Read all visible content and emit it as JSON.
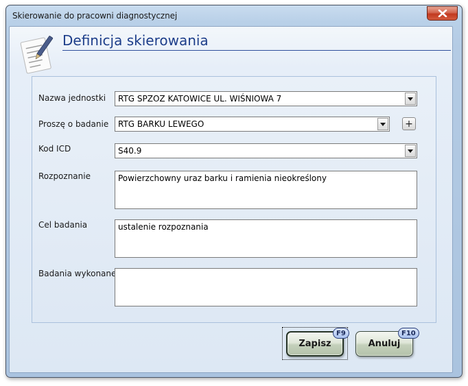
{
  "window": {
    "title": "Skierowanie do pracowni diagnostycznej"
  },
  "header": {
    "title": "Definicja skierowania",
    "icon": "clipboard-pen-icon"
  },
  "form": {
    "unit": {
      "label": "Nazwa jednostki",
      "value": "RTG SPZOZ KATOWICE UL. WIŚNIOWA 7"
    },
    "exam": {
      "label": "Proszę o badanie",
      "value": "RTG BARKU LEWEGO",
      "add_label": "+"
    },
    "icd": {
      "label": "Kod ICD",
      "value": "S40.9"
    },
    "diagnosis": {
      "label": "Rozpoznanie",
      "value": "Powierzchowny uraz barku i ramienia nieokreślony"
    },
    "purpose": {
      "label": "Cel badania",
      "value": "ustalenie rozpoznania"
    },
    "performed": {
      "label": "Badania wykonane",
      "value": ""
    }
  },
  "buttons": {
    "save": {
      "label": "Zapisz",
      "shortcut": "F9"
    },
    "cancel": {
      "label": "Anuluj",
      "shortcut": "F10"
    }
  }
}
